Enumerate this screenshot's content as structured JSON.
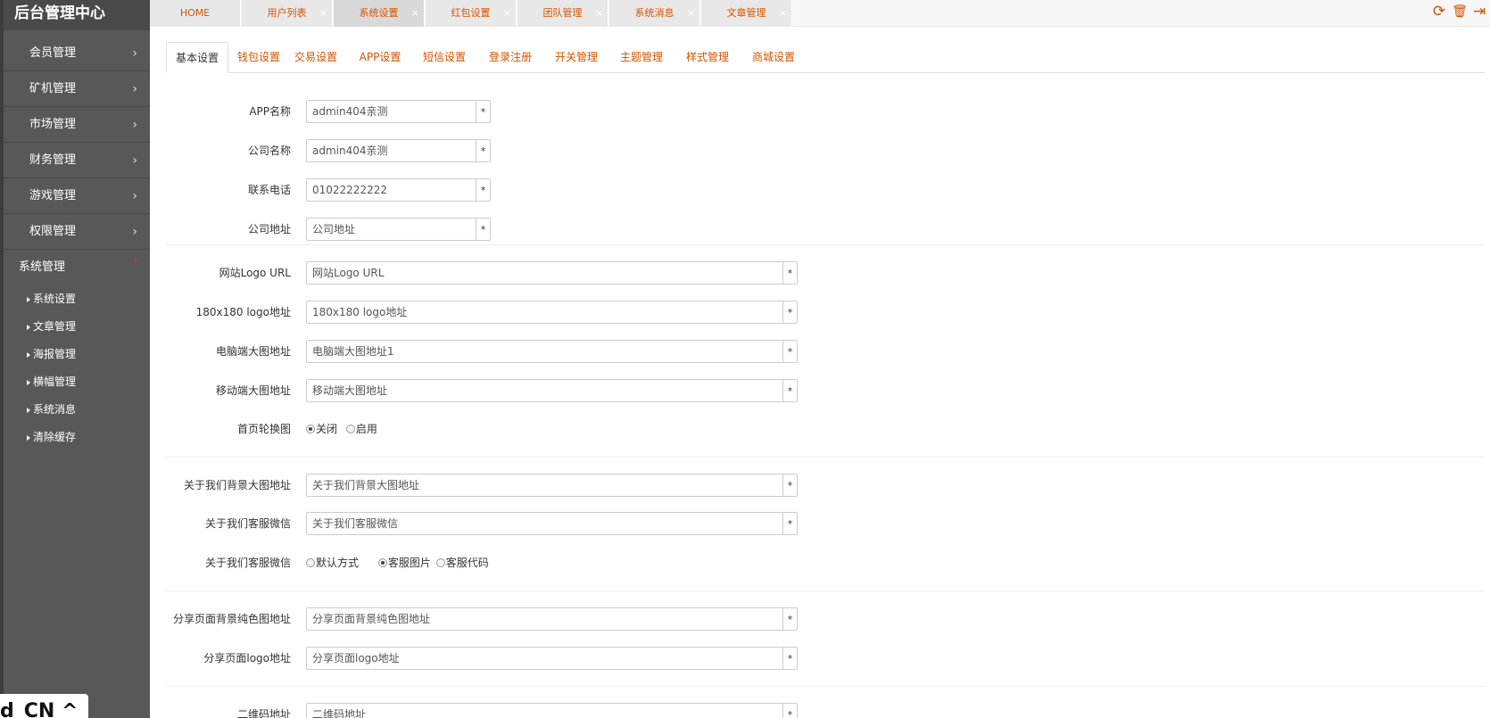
{
  "sidebar": {
    "brand": "后台管理中心",
    "items": [
      {
        "label": "会员管理",
        "chev": "›"
      },
      {
        "label": "矿机管理",
        "chev": "›"
      },
      {
        "label": "市场管理",
        "chev": "›"
      },
      {
        "label": "财务管理",
        "chev": "›"
      },
      {
        "label": "游戏管理",
        "chev": "›"
      },
      {
        "label": "权限管理",
        "chev": "›"
      },
      {
        "label": "系统管理",
        "chev": "▾"
      }
    ],
    "sub_items": [
      "系统设置",
      "文章管理",
      "海报管理",
      "横幅管理",
      "系统消息",
      "清除缓存"
    ],
    "overlay_text": "d_CN ^"
  },
  "top_tabs": [
    {
      "label": "HOME",
      "close": ""
    },
    {
      "label": "用户列表",
      "close": "×"
    },
    {
      "label": "系统设置",
      "close": "×"
    },
    {
      "label": "红包设置",
      "close": "×"
    },
    {
      "label": "团队管理",
      "close": "×"
    },
    {
      "label": "系统消息",
      "close": "×"
    },
    {
      "label": "文章管理",
      "close": "×"
    }
  ],
  "tools": {
    "refresh": "⟳",
    "trash": "🗑",
    "logout": "⇥"
  },
  "content_tabs": [
    "基本设置",
    "钱包设置",
    "交易设置",
    "APP设置",
    "短信设置",
    "登录注册",
    "开关管理",
    "主题管理",
    "样式管理",
    "商城设置"
  ],
  "form": {
    "required_mark": "*",
    "app_name": {
      "label": "APP名称",
      "value": "admin404亲测"
    },
    "company_name": {
      "label": "公司名称",
      "value": "admin404亲测"
    },
    "phone": {
      "label": "联系电话",
      "value": "01022222222"
    },
    "address": {
      "label": "公司地址",
      "value": "公司地址"
    },
    "logo_url": {
      "label": "网站Logo URL",
      "value": "网站Logo URL"
    },
    "logo_180": {
      "label": "180x180 logo地址",
      "value": "180x180 logo地址"
    },
    "pc_banner": {
      "label": "电脑端大图地址",
      "value": "电脑端大图地址1"
    },
    "mobile_banner": {
      "label": "移动端大图地址",
      "value": "移动端大图地址"
    },
    "carousel": {
      "label": "首页轮换图",
      "options": [
        "关闭",
        "启用"
      ],
      "selected": "关闭"
    },
    "about_bg": {
      "label": "关于我们背景大图地址",
      "value": "关于我们背景大图地址"
    },
    "about_wechat": {
      "label": "关于我们客服微信",
      "value": "关于我们客服微信"
    },
    "about_wechat_mode": {
      "label": "关于我们客服微信",
      "options": [
        "默认方式",
        "客服图片",
        "客服代码"
      ],
      "selected": "客服图片"
    },
    "share_bg": {
      "label": "分享页面背景纯色图地址",
      "value": "分享页面背景纯色图地址"
    },
    "share_logo": {
      "label": "分享页面logo地址",
      "value": "分享页面logo地址"
    },
    "qrcode": {
      "label": "二维码地址",
      "value": "二维码地址"
    }
  }
}
